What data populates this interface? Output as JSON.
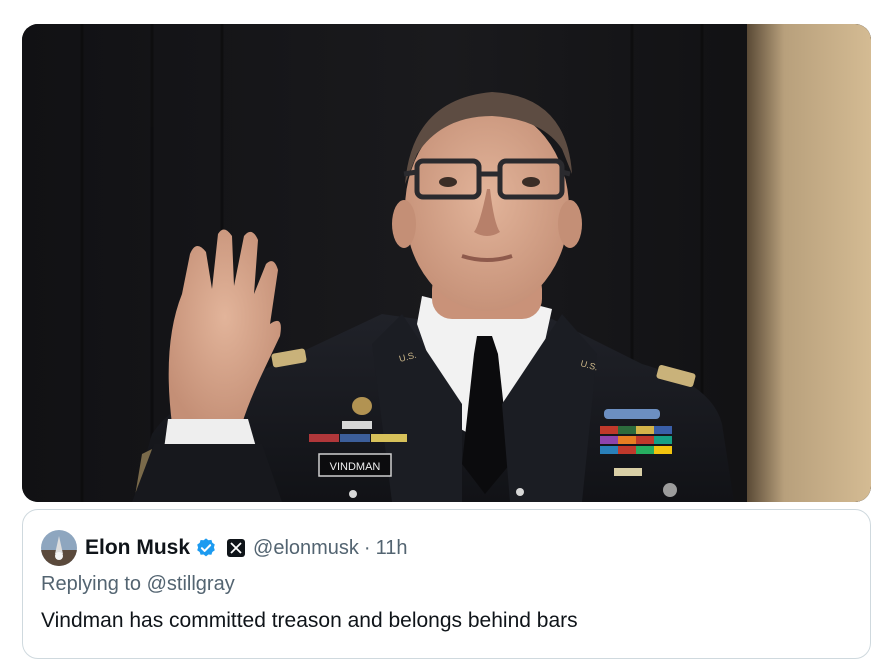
{
  "photo": {
    "nameplate_text": "VINDMAN",
    "collar_insignia_text": "U.S."
  },
  "quoted_post": {
    "author_name": "Elon Musk",
    "handle": "@elonmusk",
    "separator": "·",
    "time": "11h",
    "replying_to": "Replying to @stillgray",
    "text": "Vindman has committed treason and belongs behind bars",
    "verified_color": "#1d9bf0",
    "icons": [
      "verified-badge-icon",
      "x-logo-icon"
    ]
  }
}
